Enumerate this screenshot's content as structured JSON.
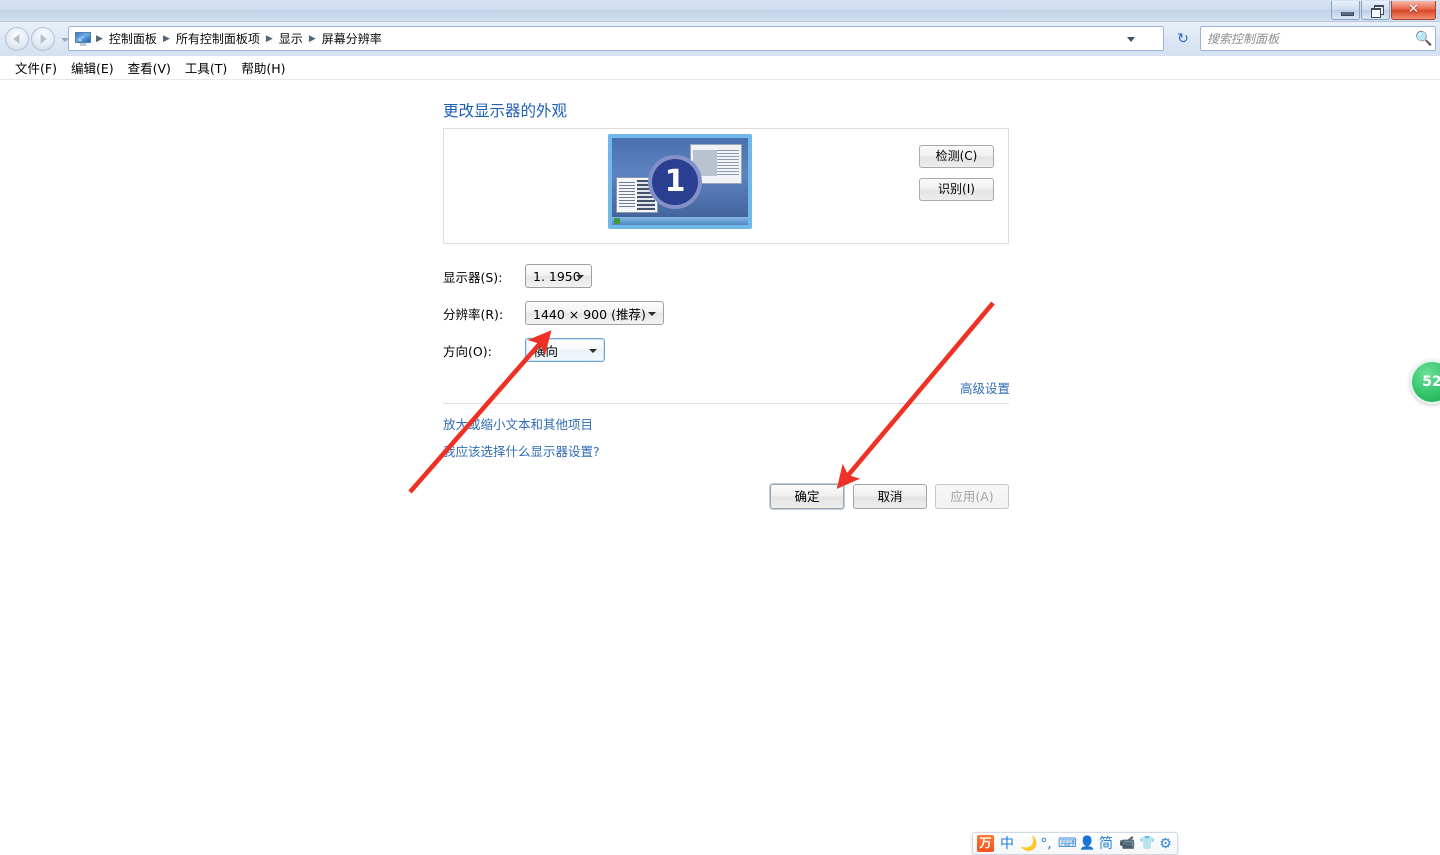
{
  "window": {
    "minimize_label": "最小化",
    "restore_label": "还原",
    "close_label": "✕"
  },
  "nav": {
    "back_label": "后退",
    "forward_label": "前进",
    "recent_dropdown_label": "最近浏览的页面",
    "refresh_label": "↻",
    "breadcrumbs": [
      {
        "label": "控制面板"
      },
      {
        "label": "所有控制面板项"
      },
      {
        "label": "显示"
      },
      {
        "label": "屏幕分辨率"
      }
    ],
    "separator": "▶"
  },
  "search": {
    "placeholder": "搜索控制面板",
    "value": "",
    "icon": "search-icon",
    "glyph": "🔍"
  },
  "menubar": {
    "items": [
      {
        "label": "文件(F)"
      },
      {
        "label": "编辑(E)"
      },
      {
        "label": "查看(V)"
      },
      {
        "label": "工具(T)"
      },
      {
        "label": "帮助(H)"
      }
    ]
  },
  "main": {
    "page_title": "更改显示器的外观",
    "monitor_number": "1",
    "detect_button": "检测(C)",
    "identify_button": "识别(I)",
    "fields": [
      {
        "label": "显示器(S):",
        "value": "1. 1950"
      },
      {
        "label": "分辨率(R):",
        "value": "1440 × 900 (推荐)"
      },
      {
        "label": "方向(O):",
        "value": "横向"
      }
    ],
    "advanced_link": "高级设置",
    "help_links": [
      {
        "label": "放大或缩小文本和其他项目"
      },
      {
        "label": "我应该选择什么显示器设置?"
      }
    ],
    "buttons": {
      "ok": "确定",
      "cancel": "取消",
      "apply": "应用(A)"
    }
  },
  "edge_widget": {
    "value": "52"
  },
  "ime": {
    "items": [
      {
        "name": "sogou-logo-icon",
        "glyph": "万"
      },
      {
        "name": "chinese-mode-icon",
        "glyph": "中"
      },
      {
        "name": "moon-icon",
        "glyph": "🌙"
      },
      {
        "name": "punctuation-icon",
        "glyph": "°,"
      },
      {
        "name": "soft-keyboard-icon",
        "glyph": "⌨"
      },
      {
        "name": "user-icon",
        "glyph": "👤"
      },
      {
        "name": "simplified-icon",
        "glyph": "简"
      },
      {
        "name": "video-icon",
        "glyph": "📹"
      },
      {
        "name": "skin-icon",
        "glyph": "👕"
      },
      {
        "name": "settings-gear-icon",
        "glyph": "⚙"
      }
    ]
  },
  "annotations": {
    "arrow_1_target": "方向(O) 下拉框",
    "arrow_2_target": "确定 按钮",
    "color": "#ee3124"
  }
}
